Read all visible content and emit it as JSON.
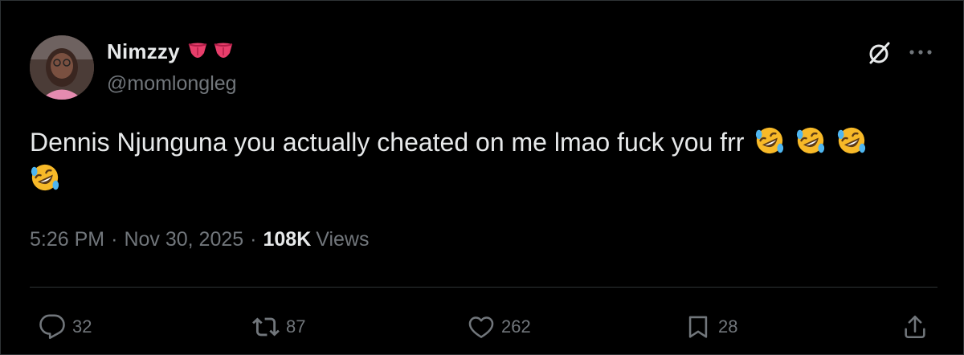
{
  "author": {
    "display_name": "Nimzzy",
    "name_emojis": [
      "tongue-emoji",
      "tongue-emoji"
    ],
    "handle": "@momlongleg"
  },
  "post": {
    "text": "Dennis Njunguna you actually cheated on me lmao fuck you frr",
    "emojis": [
      "rolling-on-floor-laughing-emoji",
      "rolling-on-floor-laughing-emoji",
      "rolling-on-floor-laughing-emoji",
      "rolling-on-floor-laughing-emoji"
    ]
  },
  "meta": {
    "time": "5:26 PM",
    "separator": "·",
    "date": "Nov 30, 2025",
    "views_count": "108K",
    "views_label": "Views"
  },
  "actions": {
    "replies": "32",
    "reposts": "87",
    "likes": "262",
    "bookmarks": "28"
  },
  "icons": {
    "reply": "reply-bubble-icon",
    "repost": "repost-icon",
    "like": "heart-icon",
    "bookmark": "bookmark-icon",
    "share": "share-icon",
    "grok": "grok-icon",
    "more": "more-dots-icon"
  },
  "colors": {
    "background": "#000000",
    "primary_text": "#e7e9ea",
    "secondary_text": "#71767b",
    "divider": "#2f3336",
    "emoji_yellow": "#f7b928"
  }
}
